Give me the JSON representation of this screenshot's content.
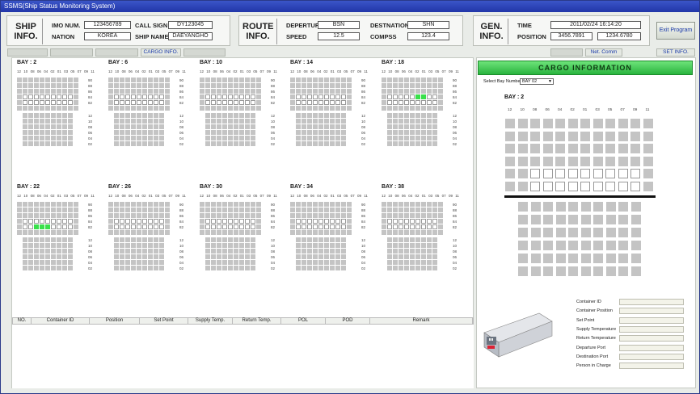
{
  "window": {
    "title": "SSMS(Ship Status Monitoring System)"
  },
  "ship_info": {
    "heading_line1": "SHIP",
    "heading_line2": "INFO.",
    "imo_label": "IMO NUM.",
    "imo_value": "123456789",
    "call_sign_label": "CALL SIGN",
    "call_sign_value": "DY123045",
    "nation_label": "NATION",
    "nation_value": "KOREA",
    "ship_name_label": "SHIP NAME",
    "ship_name_value": "DAEYANGHO"
  },
  "route_info": {
    "heading_line1": "ROUTE",
    "heading_line2": "INFO.",
    "departure_label": "DEPERTURE",
    "departure_value": "BSN",
    "destination_label": "DESTNATION",
    "destination_value": "SHN",
    "speed_label": "SPEED",
    "speed_value": "12.5",
    "compass_label": "COMPSS",
    "compass_value": "123.4"
  },
  "gen_info": {
    "heading_line1": "GEN.",
    "heading_line2": "INFO.",
    "time_label": "TIME",
    "time_value": "2011/02/24 16:14:20",
    "position_label": "POSITION",
    "position_lat": "3456.7891",
    "position_lon": "1234.6780"
  },
  "exit_button": "Exit Program",
  "tabs": {
    "tab1": "",
    "tab2": "",
    "tab3": "",
    "tab4": "CARGO INFO.",
    "tab5": ""
  },
  "right_tabs": {
    "blank": "",
    "net_comm": "Net. Comm",
    "set_info": "SET INFO."
  },
  "bays": [
    {
      "label": "BAY : 2"
    },
    {
      "label": "BAY : 6"
    },
    {
      "label": "BAY : 10"
    },
    {
      "label": "BAY : 14"
    },
    {
      "label": "BAY : 18"
    },
    {
      "label": "BAY : 22"
    },
    {
      "label": "BAY : 26"
    },
    {
      "label": "BAY : 30"
    },
    {
      "label": "BAY : 34"
    },
    {
      "label": "BAY : 38"
    }
  ],
  "column_numbers": [
    "12",
    "10",
    "08",
    "06",
    "04",
    "02",
    "01",
    "03",
    "05",
    "07",
    "09",
    "11"
  ],
  "upper_rows": [
    "90",
    "88",
    "86",
    "84",
    "82"
  ],
  "lower_rows": [
    "12",
    "10",
    "08",
    "06",
    "04",
    "02"
  ],
  "table": {
    "headers": [
      "NO.",
      "Container ID",
      "Position",
      "Set Point",
      "Supply Temp.",
      "Return Temp.",
      "POL",
      "POD",
      "Remark"
    ]
  },
  "cargo_information": {
    "title": "CARGO INFORMATION",
    "select_label": "Select Bay Number",
    "select_value": "BAY 02",
    "bay_label": "BAY : 2",
    "fields": [
      "Container ID",
      "Container Position",
      "Set Point",
      "Supply Temperature",
      "Return Temperature",
      "Departure Port",
      "Destination Port",
      "Person in Charge"
    ]
  },
  "colors": {
    "green": "#39e04a",
    "header_green": "#29b43e",
    "title_blue": "#2136a8"
  }
}
